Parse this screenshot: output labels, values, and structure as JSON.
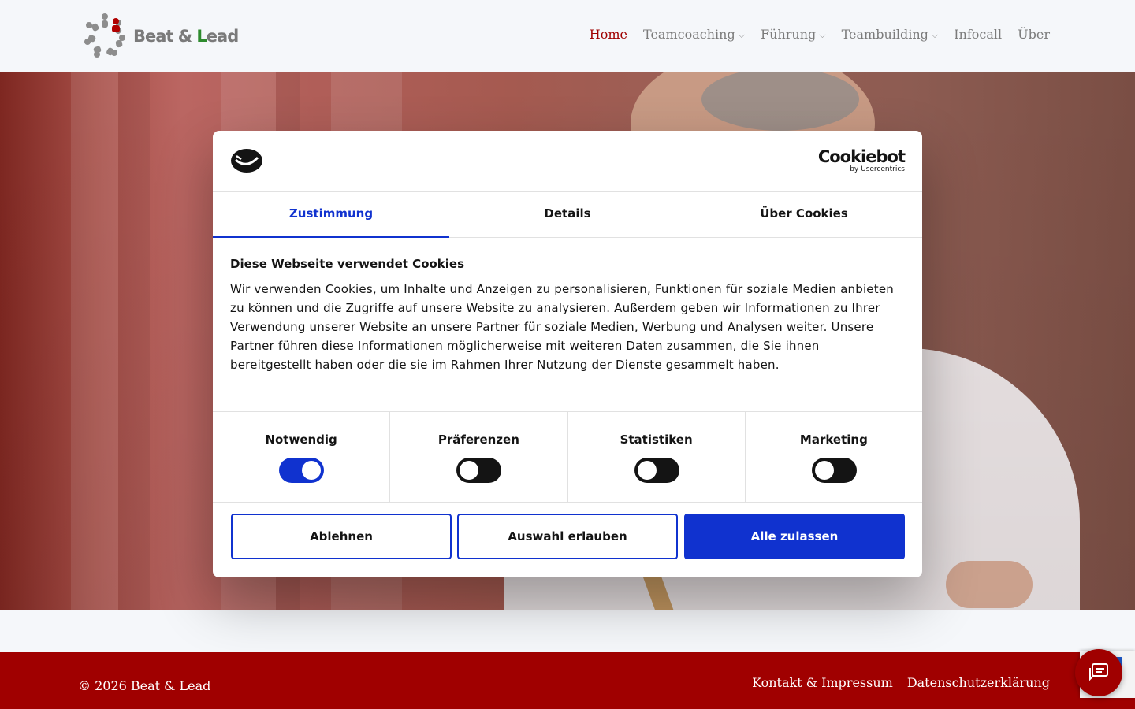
{
  "header": {
    "logo_text_a": "Beat & ",
    "logo_text_b": "L",
    "logo_text_c": "ead",
    "nav": [
      {
        "label": "Home",
        "active": true,
        "dropdown": false
      },
      {
        "label": "Teamcoaching",
        "dropdown": true
      },
      {
        "label": "Führung",
        "dropdown": true
      },
      {
        "label": "Teambuilding",
        "dropdown": true
      },
      {
        "label": "Infocall",
        "dropdown": false
      },
      {
        "label": "Über",
        "dropdown": false
      }
    ],
    "chevron": "⌵"
  },
  "cookie_dialog": {
    "brand": {
      "name": "Cookiebot",
      "by": "by Usercentrics"
    },
    "tabs": [
      "Zustimmung",
      "Details",
      "Über Cookies"
    ],
    "active_tab": "Zustimmung",
    "title": "Diese Webseite verwendet Cookies",
    "text": "Wir verwenden Cookies, um Inhalte und Anzeigen zu personalisieren, Funktionen für soziale Medien anbieten zu können und die Zugriffe auf unsere Website zu analysieren. Außerdem geben wir Informationen zu Ihrer Verwendung unserer Website an unsere Partner für soziale Medien, Werbung und Analysen weiter. Unsere Partner führen diese Informationen möglicherweise mit weiteren Daten zusammen, die Sie ihnen bereitgestellt haben oder die sie im Rahmen Ihrer Nutzung der Dienste gesammelt haben.",
    "categories": [
      {
        "label": "Notwendig",
        "enabled": true
      },
      {
        "label": "Präferenzen",
        "enabled": false
      },
      {
        "label": "Statistiken",
        "enabled": false
      },
      {
        "label": "Marketing",
        "enabled": false
      }
    ],
    "buttons": {
      "decline": "Ablehnen",
      "allow_selection": "Auswahl erlauben",
      "allow_all": "Alle zulassen"
    }
  },
  "footer": {
    "copyright": "© 2026 Beat & Lead",
    "links": [
      "Kontakt & Impressum",
      "Datenschutzerklärung"
    ]
  },
  "colors": {
    "brand_red": "#a00000",
    "cookiebot_blue": "#1032cf",
    "text_dark": "#141414"
  },
  "icons": {
    "logo": "people-circle-logo-icon",
    "cookiebot": "cookiebot-logo-icon",
    "chat": "chat-bubble-icon"
  }
}
